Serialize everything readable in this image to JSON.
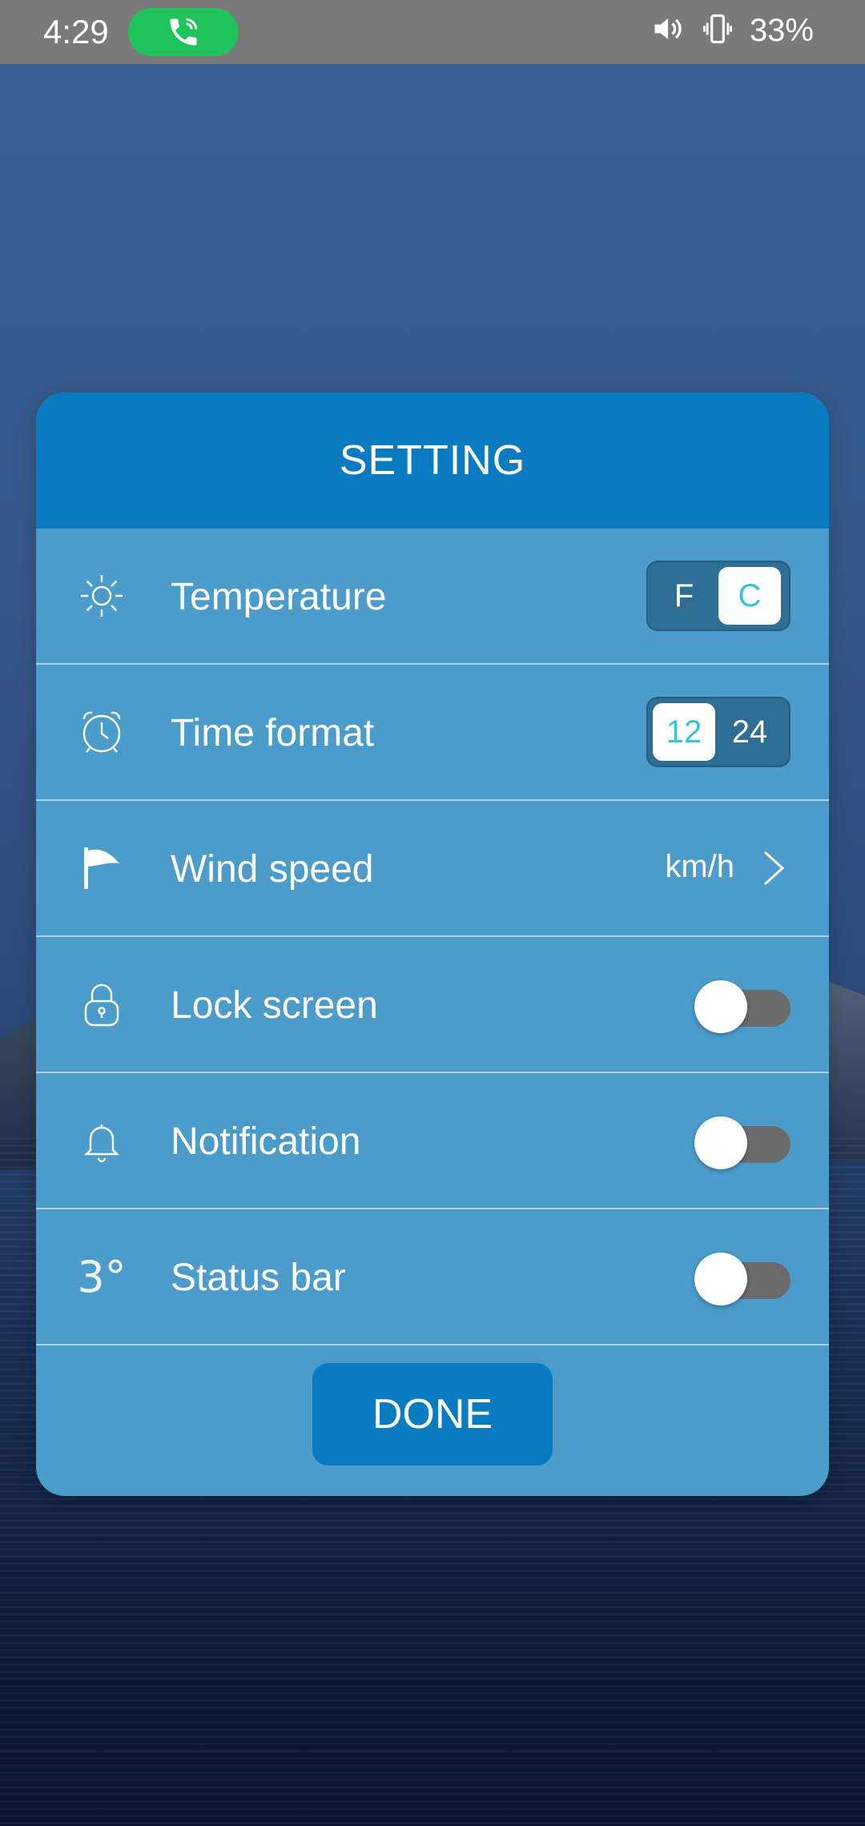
{
  "status_bar": {
    "time": "4:29",
    "battery": "33%",
    "icons": [
      "phone-call-icon",
      "volume-icon",
      "vibrate-icon"
    ]
  },
  "dialog": {
    "title": "SETTING",
    "rows": [
      {
        "label": "Temperature",
        "icon": "sun-icon",
        "control": "segmented",
        "options": [
          "F",
          "C"
        ],
        "selected": "C"
      },
      {
        "label": "Time format",
        "icon": "alarm-clock-icon",
        "control": "segmented",
        "options": [
          "12",
          "24"
        ],
        "selected": "12"
      },
      {
        "label": "Wind speed",
        "icon": "flag-icon",
        "control": "link",
        "value": "km/h"
      },
      {
        "label": "Lock screen",
        "icon": "padlock-icon",
        "control": "toggle",
        "on": false
      },
      {
        "label": "Notification",
        "icon": "bell-icon",
        "control": "toggle",
        "on": false
      },
      {
        "label": "Status bar",
        "icon": "temperature-digit-icon",
        "icon_text": "3°",
        "control": "toggle",
        "on": false
      }
    ],
    "done_label": "DONE"
  },
  "colors": {
    "header": "#0a7bc1",
    "body": "#4b9ccb",
    "accent": "#39c2cf",
    "toggle_off": "#6b6b6b",
    "call_pill": "#1fc35a"
  }
}
